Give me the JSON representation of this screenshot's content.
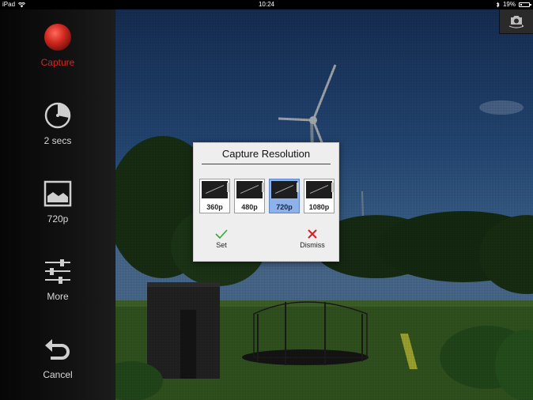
{
  "status_bar": {
    "device": "iPad",
    "time": "10:24",
    "battery": "19%",
    "battery_level": 0.19
  },
  "sidebar": {
    "capture": {
      "label": "Capture",
      "color": "#d0281f",
      "icon": "record-icon"
    },
    "timer": {
      "label": "2 secs",
      "icon": "clock-icon"
    },
    "resolution": {
      "label": "720p",
      "icon": "image-icon"
    },
    "more": {
      "label": "More",
      "icon": "sliders-icon"
    },
    "cancel": {
      "label": "Cancel",
      "icon": "undo-arrow-icon"
    }
  },
  "camera_switch": {
    "icon": "switch-camera-icon"
  },
  "dialog": {
    "title": "Capture Resolution",
    "options": [
      {
        "label": "360p",
        "selected": false
      },
      {
        "label": "480p",
        "selected": false
      },
      {
        "label": "720p",
        "selected": true
      },
      {
        "label": "1080p",
        "selected": false
      }
    ],
    "set": {
      "label": "Set",
      "color": "#3aa63a",
      "icon": "checkmark-icon"
    },
    "dismiss": {
      "label": "Dismiss",
      "color": "#d61f1f",
      "icon": "close-x-icon"
    }
  }
}
